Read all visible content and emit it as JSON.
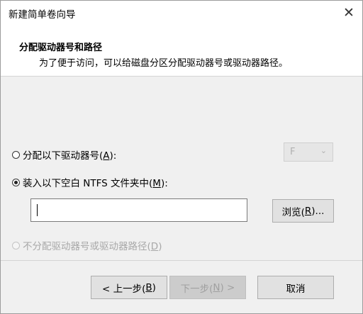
{
  "window": {
    "title": "新建简单卷向导",
    "close_glyph": "✕"
  },
  "header": {
    "title": "分配驱动器号和路径",
    "subtitle": "为了便于访问，可以给磁盘分区分配驱动器号或驱动器路径。"
  },
  "options": {
    "assign_letter": {
      "label_prefix": "分配以下驱动器号(",
      "hotkey": "A",
      "label_suffix": "):",
      "selected": false
    },
    "drive_letter_select": {
      "value": "F",
      "chevron": "⌄"
    },
    "mount_folder": {
      "label_prefix": "装入以下空白 NTFS 文件夹中(",
      "hotkey": "M",
      "label_suffix": "):",
      "selected": true
    },
    "folder_path": {
      "value": ""
    },
    "browse": {
      "label_prefix": "浏览(",
      "hotkey": "R",
      "label_suffix": ")..."
    },
    "no_assign": {
      "label_prefix": "不分配驱动器号或驱动器路径(",
      "hotkey": "D",
      "label_suffix": ")",
      "selected": false
    }
  },
  "footer": {
    "back": {
      "label_prefix": "< 上一步(",
      "hotkey": "B",
      "label_suffix": ")"
    },
    "next": {
      "label_prefix": "下一步(",
      "hotkey": "N",
      "label_suffix": ") >"
    },
    "cancel": {
      "label": "取消"
    }
  }
}
